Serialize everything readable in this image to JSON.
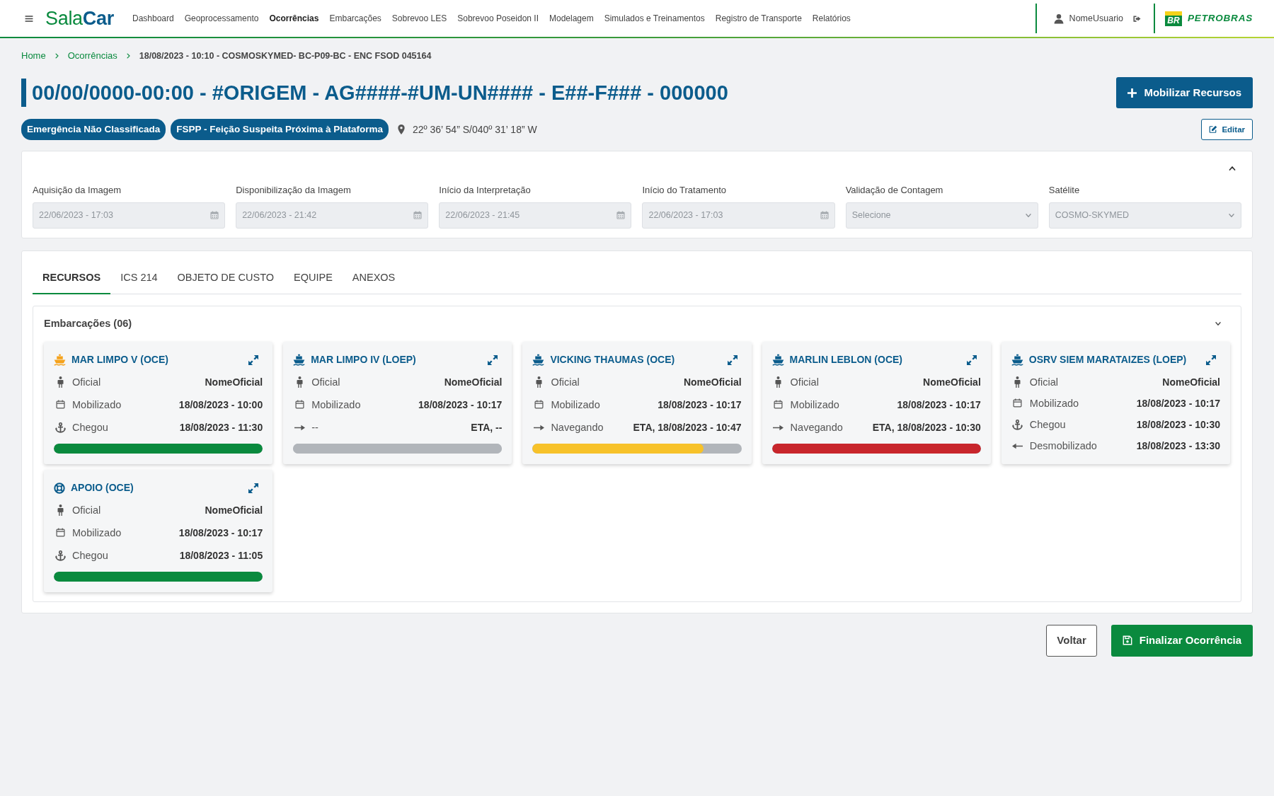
{
  "navbar": {
    "brand": "Sala**Car**",
    "menu": [
      {
        "label": "Dashboard",
        "selected": false
      },
      {
        "label": "Geoprocessamento",
        "selected": false
      },
      {
        "label": "Ocorrências",
        "selected": true
      },
      {
        "label": "Embarcações",
        "selected": false
      },
      {
        "label": "Sobrevoo LES",
        "selected": false
      },
      {
        "label": "Sobrevoo Poseidon II",
        "selected": false
      },
      {
        "label": "Modelagem",
        "selected": false
      },
      {
        "label": "Simulados e Treinamentos",
        "selected": false
      },
      {
        "label": "Registro de Transporte",
        "selected": false
      },
      {
        "label": "Relatórios",
        "selected": false
      }
    ],
    "user": {
      "name": "NomeUsuario"
    },
    "company_logo": {
      "mark": "BR",
      "name": "PETROBRAS"
    }
  },
  "breadcrumb": [
    {
      "label": "Home",
      "current": false
    },
    {
      "label": "Ocorrências",
      "current": false
    },
    {
      "label": "18/08/2023 - 10:10 - COSMOSKYMED- BC-P09-BC - ENC FSOD 045164",
      "current": true
    }
  ],
  "title": "00/00/0000-00:00 - #ORIGEM - AG####-#UM-UN#### - E##-F### - 000000",
  "mobilize_button": {
    "label": "Mobilizar Recursos"
  },
  "badges": [
    "Emergência Não Classificada",
    "FSPP - Feição Suspeita Próxima à Plataforma"
  ],
  "location": "22º 36’ 54” S/040º 31’ 18” W",
  "edit_button": {
    "label": "Editar"
  },
  "image_panel": {
    "fields": [
      {
        "label": "Aquisição da Imagem",
        "kind": "date",
        "value": "22/06/2023 - 17:03",
        "disabled": true
      },
      {
        "label": "Disponibilização da Imagem",
        "kind": "date",
        "value": "22/06/2023 - 21:42",
        "disabled": true
      },
      {
        "label": "Início da Interpretação",
        "kind": "date",
        "value": "22/06/2023 - 21:45",
        "disabled": true
      },
      {
        "label": "Início do Tratamento",
        "kind": "date",
        "value": "22/06/2023 - 17:03",
        "disabled": true
      },
      {
        "label": "Validação de Contagem",
        "kind": "select",
        "value": "Selecione",
        "disabled": true
      },
      {
        "label": "Satélite",
        "kind": "select",
        "value": "COSMO-SKYMED",
        "disabled": true
      }
    ]
  },
  "tabs": [
    {
      "label": "RECURSOS",
      "selected": true
    },
    {
      "label": "ICS 214",
      "selected": false
    },
    {
      "label": "OBJETO DE CUSTO",
      "selected": false
    },
    {
      "label": "EQUIPE",
      "selected": false
    },
    {
      "label": "ANEXOS",
      "selected": false
    }
  ],
  "vessels_panel": {
    "title": "Embarcações (06)",
    "cards": [
      {
        "title": "MAR LIMPO V (OCE)",
        "kind": "vessel",
        "color": "#f5a21b",
        "rows": [
          {
            "kind": "officer",
            "label": "Oficial",
            "value": "NomeOficial"
          },
          {
            "kind": "mobilized",
            "label": "Mobilizado",
            "value": "18/08/2023 - 10:00"
          },
          {
            "kind": "arrived",
            "label": "Chegou",
            "value": "18/08/2023 - 11:30"
          }
        ],
        "progress": {
          "level": 1,
          "color": "#0a8a3e"
        }
      },
      {
        "title": "MAR LIMPO IV (LOEP)",
        "kind": "vessel",
        "color": "#0b5c8c",
        "rows": [
          {
            "kind": "officer",
            "label": "Oficial",
            "value": "NomeOficial"
          },
          {
            "kind": "mobilized",
            "label": "Mobilizado",
            "value": "18/08/2023 - 10:17"
          },
          {
            "kind": "underway",
            "label": "--",
            "value": "ETA, --"
          }
        ],
        "progress": {
          "level": 1,
          "color": "#b1b5ba"
        }
      },
      {
        "title": "VICKING THAUMAS (OCE)",
        "kind": "vessel",
        "color": "#0b5c8c",
        "rows": [
          {
            "kind": "officer",
            "label": "Oficial",
            "value": "NomeOficial"
          },
          {
            "kind": "mobilized",
            "label": "Mobilizado",
            "value": "18/08/2023 - 10:17"
          },
          {
            "kind": "underway",
            "label": "Navegando",
            "value": "ETA, 18/08/2023 - 10:47"
          }
        ],
        "progress": {
          "level": 0.82,
          "color": "#f7c22a"
        }
      },
      {
        "title": "MARLIN LEBLON (OCE)",
        "kind": "vessel",
        "color": "#0b5c8c",
        "rows": [
          {
            "kind": "officer",
            "label": "Oficial",
            "value": "NomeOficial"
          },
          {
            "kind": "mobilized",
            "label": "Mobilizado",
            "value": "18/08/2023 - 10:17"
          },
          {
            "kind": "underway",
            "label": "Navegando",
            "value": "ETA, 18/08/2023 - 10:30"
          }
        ],
        "progress": {
          "level": 1,
          "color": "#c8262c"
        }
      },
      {
        "title": "OSRV SIEM MARATAIZES (LOEP)",
        "kind": "vessel",
        "color": "#0b5c8c",
        "rows": [
          {
            "kind": "officer",
            "label": "Oficial",
            "value": "NomeOficial"
          },
          {
            "kind": "mobilized",
            "label": "Mobilizado",
            "value": "18/08/2023 - 10:17"
          },
          {
            "kind": "arrived",
            "label": "Chegou",
            "value": "18/08/2023 - 10:30"
          },
          {
            "kind": "demobilized",
            "label": "Desmobilizado",
            "value": "18/08/2023 - 13:30"
          }
        ]
      },
      {
        "title": "APOIO (OCE)",
        "kind": "support",
        "color": "#0b5c8c",
        "rows": [
          {
            "kind": "officer",
            "label": "Oficial",
            "value": "NomeOficial"
          },
          {
            "kind": "mobilized",
            "label": "Mobilizado",
            "value": "18/08/2023 - 10:17"
          },
          {
            "kind": "arrived",
            "label": "Chegou",
            "value": "18/08/2023 - 11:05"
          }
        ],
        "progress": {
          "level": 1,
          "color": "#0a8a3e"
        }
      }
    ]
  },
  "footer_buttons": [
    {
      "label": "Voltar",
      "kind": "secondary"
    },
    {
      "label": "Finalizar Ocorrência",
      "kind": "primary"
    }
  ]
}
